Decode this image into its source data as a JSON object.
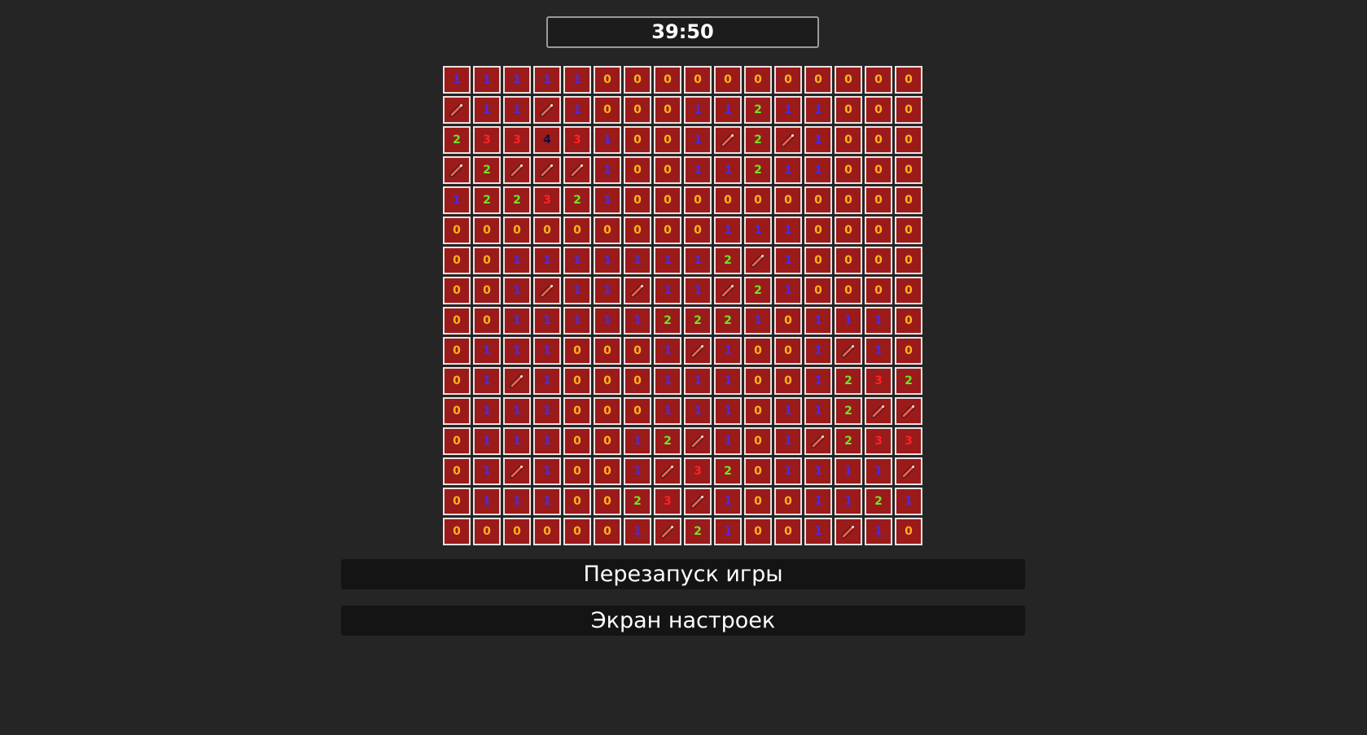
{
  "timer": "39:50",
  "board": [
    [
      "1",
      "1",
      "1",
      "1",
      "1",
      "0",
      "0",
      "0",
      "0",
      "0",
      "0",
      "0",
      "0",
      "0",
      "0",
      "0"
    ],
    [
      "F",
      "1",
      "1",
      "F",
      "1",
      "0",
      "0",
      "0",
      "1",
      "1",
      "2",
      "1",
      "1",
      "0",
      "0",
      "0"
    ],
    [
      "2",
      "3",
      "3",
      "4",
      "3",
      "1",
      "0",
      "0",
      "1",
      "F",
      "2",
      "F",
      "1",
      "0",
      "0",
      "0"
    ],
    [
      "F",
      "2",
      "F",
      "F",
      "F",
      "1",
      "0",
      "0",
      "1",
      "1",
      "2",
      "1",
      "1",
      "0",
      "0",
      "0"
    ],
    [
      "1",
      "2",
      "2",
      "3",
      "2",
      "1",
      "0",
      "0",
      "0",
      "0",
      "0",
      "0",
      "0",
      "0",
      "0",
      "0"
    ],
    [
      "0",
      "0",
      "0",
      "0",
      "0",
      "0",
      "0",
      "0",
      "0",
      "1",
      "1",
      "1",
      "0",
      "0",
      "0",
      "0"
    ],
    [
      "0",
      "0",
      "1",
      "1",
      "1",
      "1",
      "1",
      "1",
      "1",
      "2",
      "F",
      "1",
      "0",
      "0",
      "0",
      "0"
    ],
    [
      "0",
      "0",
      "1",
      "F",
      "1",
      "1",
      "F",
      "1",
      "1",
      "F",
      "2",
      "1",
      "0",
      "0",
      "0",
      "0"
    ],
    [
      "0",
      "0",
      "1",
      "1",
      "1",
      "1",
      "1",
      "2",
      "2",
      "2",
      "1",
      "0",
      "1",
      "1",
      "1",
      "0"
    ],
    [
      "0",
      "1",
      "1",
      "1",
      "0",
      "0",
      "0",
      "1",
      "F",
      "1",
      "0",
      "0",
      "1",
      "F",
      "1",
      "0"
    ],
    [
      "0",
      "1",
      "F",
      "1",
      "0",
      "0",
      "0",
      "1",
      "1",
      "1",
      "0",
      "0",
      "1",
      "2",
      "3",
      "2"
    ],
    [
      "0",
      "1",
      "1",
      "1",
      "0",
      "0",
      "0",
      "1",
      "1",
      "1",
      "0",
      "1",
      "1",
      "2",
      "F",
      "F"
    ],
    [
      "0",
      "1",
      "1",
      "1",
      "0",
      "0",
      "1",
      "2",
      "F",
      "1",
      "0",
      "1",
      "F",
      "2",
      "3",
      "3"
    ],
    [
      "0",
      "1",
      "F",
      "1",
      "0",
      "0",
      "1",
      "F",
      "3",
      "2",
      "0",
      "1",
      "1",
      "1",
      "1",
      "F"
    ],
    [
      "0",
      "1",
      "1",
      "1",
      "0",
      "0",
      "2",
      "3",
      "F",
      "1",
      "0",
      "0",
      "1",
      "1",
      "2",
      "1"
    ],
    [
      "0",
      "0",
      "0",
      "0",
      "0",
      "0",
      "1",
      "F",
      "2",
      "1",
      "0",
      "0",
      "1",
      "F",
      "1",
      "0"
    ]
  ],
  "buttons": {
    "restart": "Перезапуск игры",
    "settings": "Экран настроек"
  }
}
